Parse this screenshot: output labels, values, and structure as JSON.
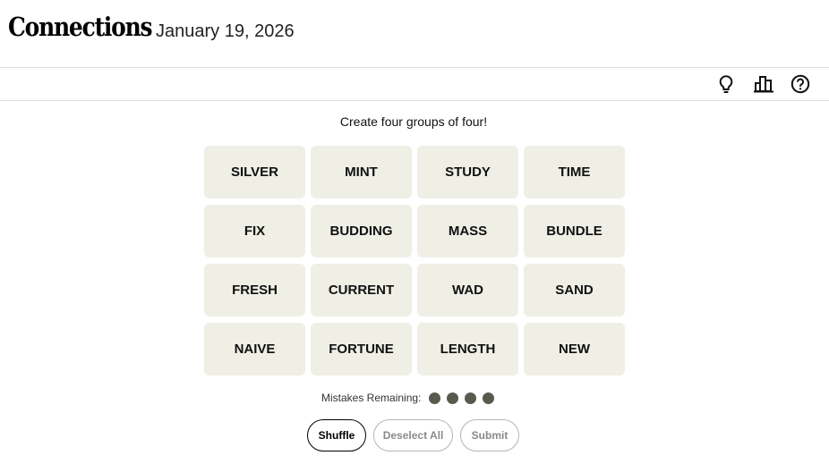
{
  "header": {
    "title": "Connections",
    "date": "January 19, 2026"
  },
  "toolbar": {
    "icons": [
      "hint-lightbulb-icon",
      "stats-bar-chart-icon",
      "help-question-icon"
    ]
  },
  "instructions": "Create four groups of four!",
  "tiles": [
    "SILVER",
    "MINT",
    "STUDY",
    "TIME",
    "FIX",
    "BUDDING",
    "MASS",
    "BUNDLE",
    "FRESH",
    "CURRENT",
    "WAD",
    "SAND",
    "NAIVE",
    "FORTUNE",
    "LENGTH",
    "NEW"
  ],
  "mistakes": {
    "label": "Mistakes Remaining:",
    "remaining": 4
  },
  "buttons": {
    "shuffle": "Shuffle",
    "deselect": "Deselect All",
    "submit": "Submit"
  },
  "colors": {
    "tile_bg": "#efefe6",
    "mistake_dot": "#5a594e"
  }
}
